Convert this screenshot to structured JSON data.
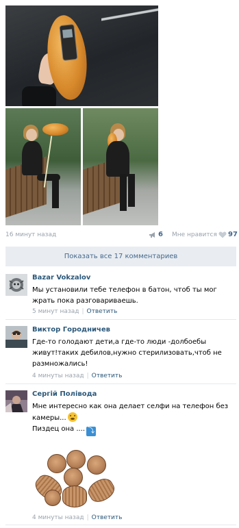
{
  "post": {
    "time": "16 минут назад",
    "share_count": "6",
    "like_label": "Мне нравится",
    "like_count": "97",
    "icons": {
      "share": "megaphone-icon",
      "like": "heart-icon"
    }
  },
  "show_all_comments": "Показать все 17 комментариев",
  "comments": [
    {
      "author": "Bazar Vokzalov",
      "text": "Мы установили тебе телефон в батон, чтоб ты мог жрать пока разговариваешь.",
      "time": "5 минут назад",
      "reply": "Ответить"
    },
    {
      "author": "Виктор Городничев",
      "text": "Где-то голодают дети,а где-то люди -долбоебы живут!таких дебилов,нужно стерилизовать,чтоб не размножались!",
      "time": "4 минуты назад",
      "reply": "Ответить"
    },
    {
      "author": "Сергій Полівода",
      "text_line1": "Мне интересно как она делает селфи на телефон без камеры...",
      "text_line2": "Пиздец она ....",
      "time": "4 минуты назад",
      "reply": "Ответить"
    }
  ],
  "colors": {
    "link": "#2b587a",
    "muted": "#9aa3ad",
    "button_bg": "#e9edf1"
  }
}
